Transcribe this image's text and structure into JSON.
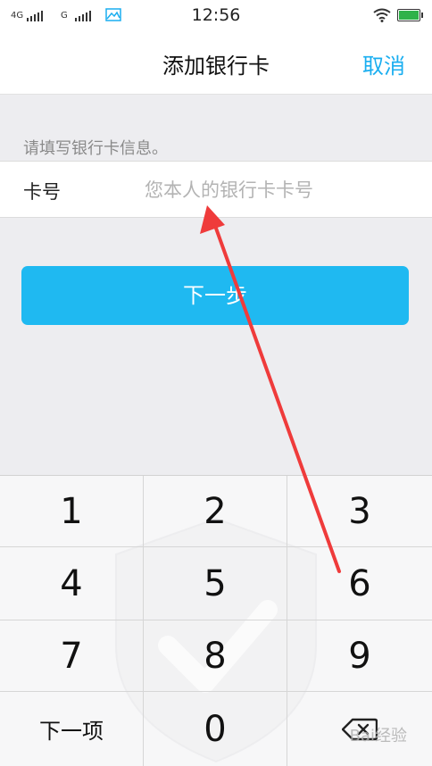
{
  "status_bar": {
    "network_1": "4G",
    "network_2": "G",
    "time": "12:56",
    "battery_color": "#2fb24a"
  },
  "nav": {
    "title": "添加银行卡",
    "cancel": "取消"
  },
  "form": {
    "hint": "请填写银行卡信息。",
    "card_label": "卡号",
    "card_placeholder": "您本人的银行卡卡号",
    "card_value": ""
  },
  "next_button": "下一步",
  "keypad": {
    "keys": [
      "1",
      "2",
      "3",
      "4",
      "5",
      "6",
      "7",
      "8",
      "9",
      "下一项",
      "0",
      "delete-icon"
    ]
  },
  "annotation": {
    "arrow_color": "#ef3b3b"
  },
  "watermark": "Bai经验",
  "accent_color": "#1fb9f1"
}
